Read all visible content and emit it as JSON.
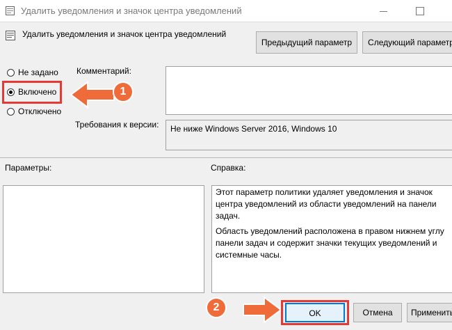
{
  "window": {
    "title": "Удалить уведомления и значок центра уведомлений",
    "icon": "policy-icon"
  },
  "header": {
    "policy_title": "Удалить уведомления и значок центра уведомлений",
    "prev_button": "Предыдущий параметр",
    "next_button": "Следующий параметр"
  },
  "state": {
    "options": [
      {
        "label": "Не задано",
        "selected": false
      },
      {
        "label": "Включено",
        "selected": true
      },
      {
        "label": "Отключено",
        "selected": false
      }
    ]
  },
  "comment": {
    "label": "Комментарий:",
    "value": ""
  },
  "requirements": {
    "label": "Требования к версии:",
    "value": "Не ниже Windows Server 2016, Windows 10"
  },
  "params": {
    "label": "Параметры:"
  },
  "help": {
    "label": "Справка:",
    "paragraphs": [
      "Этот параметр политики удаляет уведомления и значок центра уведомлений из области уведомлений на панели задач.",
      "Область уведомлений расположена в правом нижнем углу панели задач и содержит значки текущих уведомлений и системные часы."
    ]
  },
  "annotations": {
    "step1": "1",
    "step2": "2",
    "highlight_color": "#e53935",
    "arrow_color": "#ef6b3a"
  },
  "footer": {
    "ok": "OK",
    "cancel": "Отмена",
    "apply": "Применить"
  }
}
